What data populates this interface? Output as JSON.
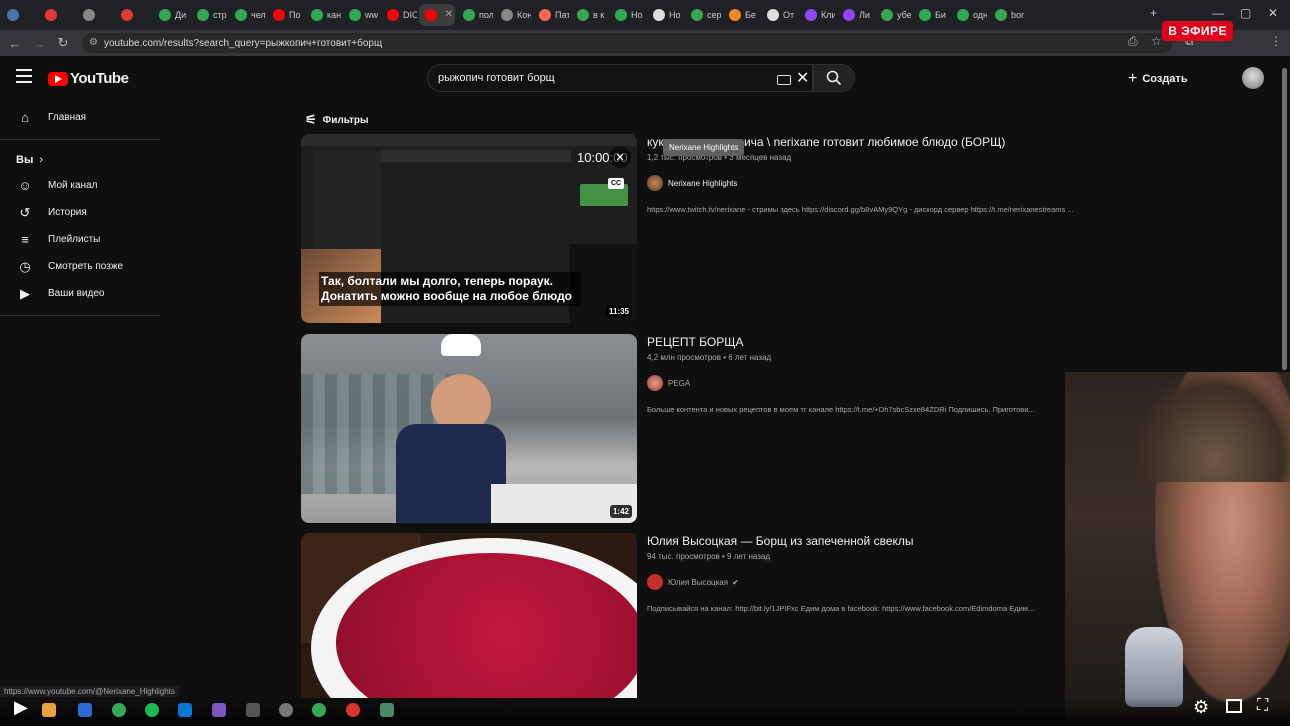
{
  "browser": {
    "live_badge": "В ЭФИРЕ",
    "url": "youtube.com/results?search_query=рыжкопич+готовит+борщ",
    "tabs": [
      {
        "icon": "vk-icon",
        "color": "#4a76a8",
        "label": ""
      },
      {
        "icon": "opera-icon",
        "color": "#e03a3e",
        "label": ""
      },
      {
        "icon": "app-icon",
        "color": "#888888",
        "label": ""
      },
      {
        "icon": "opera-icon",
        "color": "#e03a3e",
        "label": ""
      },
      {
        "icon": "chrome-icon",
        "color": "#34a853",
        "label": "Ди"
      },
      {
        "icon": "chrome-icon",
        "color": "#34a853",
        "label": "стр"
      },
      {
        "icon": "chrome-icon",
        "color": "#34a853",
        "label": "чел"
      },
      {
        "icon": "youtube-icon",
        "color": "#ff0000",
        "label": "По"
      },
      {
        "icon": "chrome-icon",
        "color": "#34a853",
        "label": "кан"
      },
      {
        "icon": "chrome-icon",
        "color": "#34a853",
        "label": "ww"
      },
      {
        "icon": "youtube-icon",
        "color": "#ff0000",
        "label": "DIO"
      },
      {
        "icon": "youtube-icon",
        "color": "#ff0000",
        "label": ""
      },
      {
        "icon": "chrome-icon",
        "color": "#34a853",
        "label": "пол"
      },
      {
        "icon": "gear-icon",
        "color": "#888888",
        "label": "Кон"
      },
      {
        "icon": "patreon-icon",
        "color": "#f96854",
        "label": "Пат"
      },
      {
        "icon": "chrome-icon",
        "color": "#34a853",
        "label": "в к"
      },
      {
        "icon": "chrome-icon",
        "color": "#34a853",
        "label": "Но"
      },
      {
        "icon": "app-icon",
        "color": "#dddddd",
        "label": "Но"
      },
      {
        "icon": "chrome-icon",
        "color": "#34a853",
        "label": "сер"
      },
      {
        "icon": "app-icon",
        "color": "#f28b25",
        "label": "Бе"
      },
      {
        "icon": "dtf-icon",
        "color": "#dddddd",
        "label": "От"
      },
      {
        "icon": "twitch-icon",
        "color": "#9146ff",
        "label": "Кли"
      },
      {
        "icon": "twitch-icon",
        "color": "#9146ff",
        "label": "Ли"
      },
      {
        "icon": "chrome-icon",
        "color": "#34a853",
        "label": "убе"
      },
      {
        "icon": "chrome-icon",
        "color": "#34a853",
        "label": "Би"
      },
      {
        "icon": "chrome-icon",
        "color": "#34a853",
        "label": "одн"
      },
      {
        "icon": "chrome-icon",
        "color": "#34a853",
        "label": "bor"
      }
    ]
  },
  "youtube": {
    "logo_text": "YouTube",
    "search_value": "рыжопич готовит борщ",
    "create_label": "Создать",
    "sidebar": {
      "home": "Главная",
      "you_label": "Вы",
      "items": [
        "Мой канал",
        "История",
        "Плейлисты",
        "Смотреть позже",
        "Ваши видео"
      ]
    },
    "filters_label": "Фильтры",
    "tooltip": "Nerixane Highlights",
    "results": [
      {
        "title": "кукушечка рыжопича \\ nerixane готовит любимое блюдо (БОРЩ)",
        "meta": "1,2 тыс. просмотров • 3 месяцев назад",
        "channel": "Nerixane Highlights",
        "description": "https://www.twitch.tv/nerixane - стримы здесь https://discord.gg/b8vAMy9QYg - дискорд сервер https://t.me/nerixanestreams ...",
        "duration": "11:35",
        "timer": "10:00:00",
        "caption": "Так, болтали мы долго, теперь пораук. Донатить можно вообще на любое блюдо",
        "cc": "CC"
      },
      {
        "title": "РЕЦЕПТ БОРЩА",
        "meta": "4,2 млн просмотров • 6 лет назад",
        "channel": "PEGA",
        "description": "Больше контента и новых рецептов в моем тг канале https://t.me/+Dh7sbcSzxe84ZDRi Подпишись. Приготови...",
        "duration": "1:42"
      },
      {
        "title": "Юлия Высоцкая — Борщ из запеченной свеклы",
        "meta": "94 тыс. просмотров • 9 лет назад",
        "channel": "Юлия Высоцкая",
        "description": "Подписывайся на канал: http://bit.ly/1JPIFxc Едим дома в facebook: https://www.facebook.com/Edimdoma Едим..."
      }
    ],
    "status_url": "https://www.youtube.com/@Nerixane_Highlights"
  }
}
